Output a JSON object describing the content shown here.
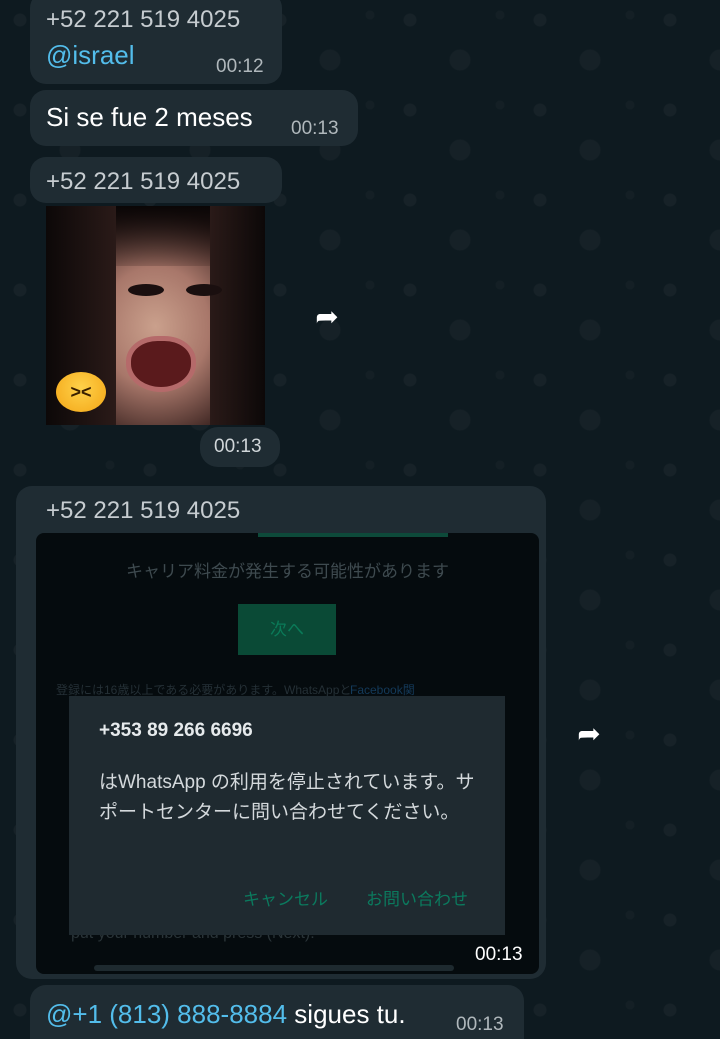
{
  "messages": [
    {
      "sender": "+52 221 519 4025",
      "mention": "@israel",
      "time": "00:12"
    },
    {
      "text": "Si se fue 2 meses",
      "time": "00:13"
    },
    {
      "sender": "+52 221 519 4025",
      "sticker": "angry-girl-sticker",
      "emoji": "angry-face",
      "time": "00:13"
    },
    {
      "sender": "+52 221 519 4025",
      "time": "00:13",
      "screenshot": {
        "carrier_text": "キャリア料金が発生する可能性があります",
        "next_button": "次へ",
        "fine_print": "登録には16歳以上である必要があります。WhatsAppと",
        "fine_print_tail": "Facebook関",
        "background_text": "put your number and press (Next).",
        "dialog": {
          "title": "+353 89 266 6696",
          "body": "はWhatsApp の利用を停止されています。サポートセンターに問い合わせてください。",
          "cancel": "キャンセル",
          "contact": "お問い合わせ"
        }
      }
    },
    {
      "mention": "@+1 (813) 888-8884",
      "text": " sigues tu.",
      "time": "00:13"
    }
  ],
  "colors": {
    "bubble": "#1f2c33",
    "mention": "#53bdeb",
    "background": "#0b141a"
  }
}
